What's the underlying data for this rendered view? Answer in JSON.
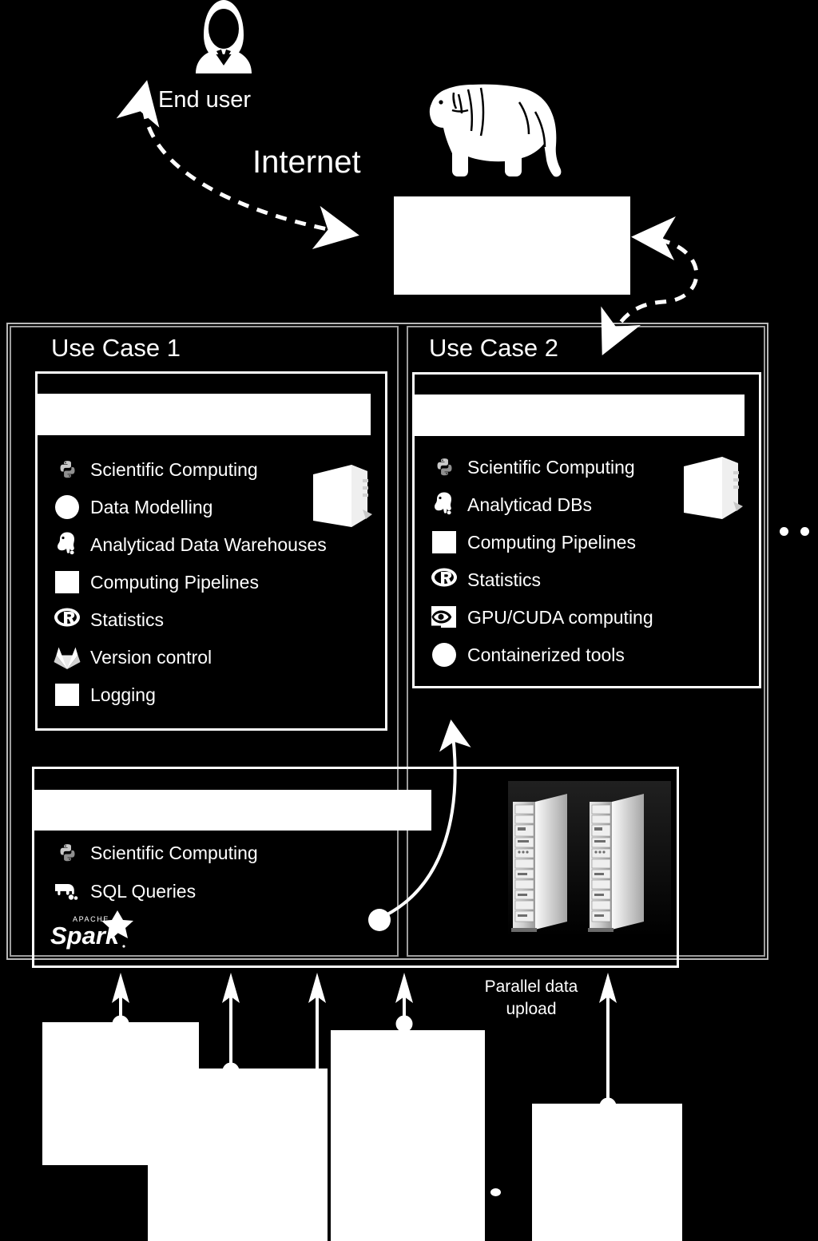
{
  "diagram": {
    "title_hidden": "",
    "background_color": "#000000",
    "foreground_color": "#ffffff"
  },
  "top": {
    "end_user_label": "End user",
    "internet_label": "Internet",
    "end_user_icon": "person-avatar-icon",
    "internet_icon": "bulldog-icon",
    "gateway_box": "",
    "arrow_enduser_to_gateway": "dashed-bidirectional-arrow",
    "arrow_gateway_to_usecase2": "dashed-bidirectional-arrow"
  },
  "use_case_1": {
    "title": "Use Case 1",
    "header_bar": "",
    "server_icon": "server-box-icon",
    "items": [
      {
        "icon": "python-icon",
        "label": "Scientific Computing"
      },
      {
        "icon": "circle-icon",
        "label": "Data Modelling"
      },
      {
        "icon": "postgresql-elephant-icon",
        "label": "Analyticad Data Warehouses"
      },
      {
        "icon": "square-icon",
        "label": "Computing Pipelines"
      },
      {
        "icon": "r-language-icon",
        "label": "Statistics"
      },
      {
        "icon": "gitlab-fox-icon",
        "label": "Version control"
      },
      {
        "icon": "square-icon",
        "label": "Logging"
      }
    ]
  },
  "use_case_2": {
    "title": "Use Case 2",
    "header_bar": "",
    "server_icon": "server-box-icon",
    "items": [
      {
        "icon": "python-icon",
        "label": "Scientific Computing"
      },
      {
        "icon": "postgresql-elephant-icon",
        "label": "Analyticad DBs"
      },
      {
        "icon": "square-icon",
        "label": "Computing Pipelines"
      },
      {
        "icon": "r-language-icon",
        "label": "Statistics"
      },
      {
        "icon": "nvidia-eye-icon",
        "label": "GPU/CUDA computing"
      },
      {
        "icon": "circle-icon",
        "label": "Containerized tools"
      }
    ]
  },
  "more_use_cases_ellipsis": "• • •",
  "data_layer": {
    "header_bar": "",
    "items": [
      {
        "icon": "python-icon",
        "label": "Scientific Computing"
      },
      {
        "icon": "hadoop-elephant-icon",
        "label": "SQL Queries"
      },
      {
        "icon": "apache-spark-logo",
        "label": ""
      }
    ],
    "spark_logo": {
      "apache_text": "APACHE",
      "spark_text": "Spark",
      "tm_mark": "."
    },
    "server_racks_icon": "server-rack-pair-icon",
    "arrow_to_use_case_2": "curved-solid-arrow"
  },
  "bottom": {
    "parallel_upload_label_line1": "Parallel data",
    "parallel_upload_label_line2": "upload",
    "upload_arrows_count": 5,
    "source_blocks": [
      "",
      "",
      "",
      ""
    ],
    "sources_ellipsis": "• • •"
  }
}
